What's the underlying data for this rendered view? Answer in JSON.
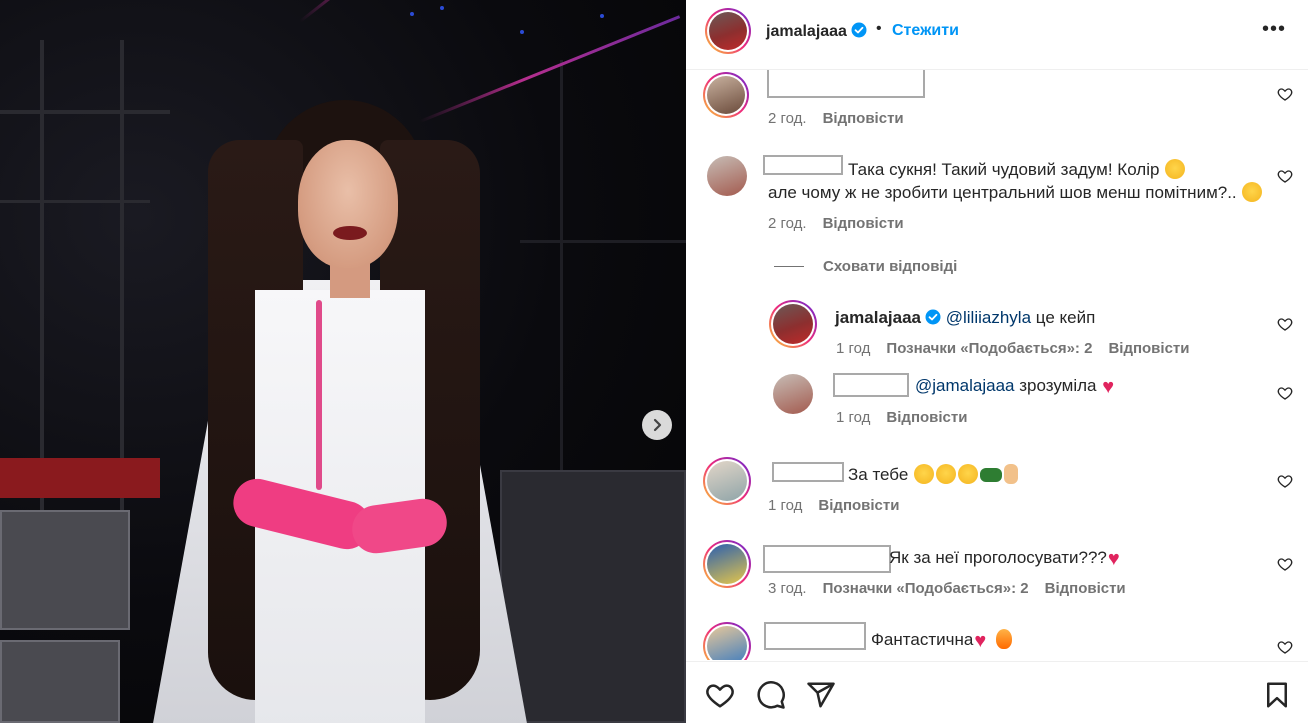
{
  "post": {
    "username": "jamalajaaa",
    "dot": "•",
    "follow_label": "Стежити",
    "more_label": "•••"
  },
  "comments": [
    {
      "time": "2 год.",
      "reply_label": "Відповісти"
    },
    {
      "text": "Така сукня! Такий чудовий задум! Колір",
      "text_line2": "але чому ж не зробити центральний шов менш помітним?..",
      "time": "2 год.",
      "reply_label": "Відповісти"
    },
    {
      "text": "За тебе",
      "time": "1 год",
      "reply_label": "Відповісти"
    },
    {
      "text": "Як за неї проголосувати???",
      "time": "3 год.",
      "likes_label": "Позначки «Подобається»: 2",
      "reply_label": "Відповісти"
    },
    {
      "text": "Фантастична"
    }
  ],
  "thread": {
    "hide_replies_label": "Сховати відповіді",
    "replies": [
      {
        "username": "jamalajaaa",
        "mention": "@liliiazhyla",
        "text": "це кейп",
        "time": "1 год",
        "likes_label": "Позначки «Подобається»: 2",
        "reply_label": "Відповісти"
      },
      {
        "mention": "@jamalajaaa",
        "text": "зрозуміла",
        "time": "1 год",
        "reply_label": "Відповісти"
      }
    ]
  },
  "icons": {
    "like": "heart-outline-icon",
    "comment": "comment-bubble-icon",
    "share": "paper-plane-icon",
    "save": "bookmark-icon",
    "next": "chevron-right-icon",
    "verified": "verified-badge-icon"
  },
  "colors": {
    "follow": "#0095f6",
    "text": "#262626",
    "meta": "#737373",
    "mention": "#00376b"
  }
}
